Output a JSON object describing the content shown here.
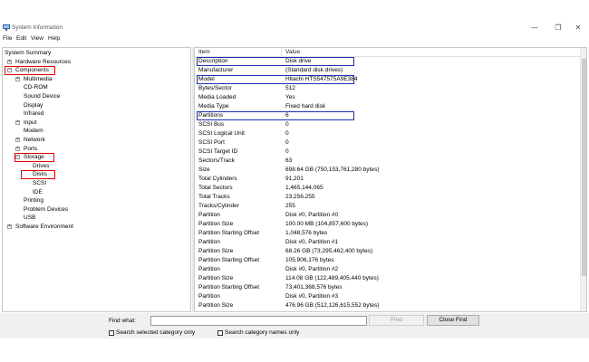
{
  "window": {
    "title": "System Information",
    "controls": {
      "minimize": "—",
      "maximize": "❐",
      "close": "✕"
    }
  },
  "menu": [
    "File",
    "Edit",
    "View",
    "Help"
  ],
  "tree": [
    {
      "label": "System Summary",
      "level": 0,
      "expander": ""
    },
    {
      "label": "Hardware Resources",
      "level": 1,
      "expander": "+"
    },
    {
      "label": "Components",
      "level": 1,
      "expander": "−"
    },
    {
      "label": "Multimedia",
      "level": 2,
      "expander": "+"
    },
    {
      "label": "CD-ROM",
      "level": 2,
      "expander": ""
    },
    {
      "label": "Sound Device",
      "level": 2,
      "expander": ""
    },
    {
      "label": "Display",
      "level": 2,
      "expander": ""
    },
    {
      "label": "Infrared",
      "level": 2,
      "expander": ""
    },
    {
      "label": "Input",
      "level": 2,
      "expander": "+"
    },
    {
      "label": "Modem",
      "level": 2,
      "expander": ""
    },
    {
      "label": "Network",
      "level": 2,
      "expander": "+"
    },
    {
      "label": "Ports",
      "level": 2,
      "expander": "+"
    },
    {
      "label": "Storage",
      "level": 2,
      "expander": "−"
    },
    {
      "label": "Drives",
      "level": 3,
      "expander": ""
    },
    {
      "label": "Disks",
      "level": 3,
      "expander": ""
    },
    {
      "label": "SCSI",
      "level": 3,
      "expander": ""
    },
    {
      "label": "IDE",
      "level": 3,
      "expander": ""
    },
    {
      "label": "Printing",
      "level": 2,
      "expander": ""
    },
    {
      "label": "Problem Devices",
      "level": 2,
      "expander": ""
    },
    {
      "label": "USB",
      "level": 2,
      "expander": ""
    },
    {
      "label": "Software Environment",
      "level": 1,
      "expander": "+"
    }
  ],
  "list": {
    "columns": {
      "item": "Item",
      "value": "Value"
    },
    "rows": [
      {
        "item": "Description",
        "value": "Disk drive"
      },
      {
        "item": "Manufacturer",
        "value": "(Standard disk drives)"
      },
      {
        "item": "Model",
        "value": "Hitachi HTS547575A9E384"
      },
      {
        "item": "Bytes/Sector",
        "value": "512"
      },
      {
        "item": "Media Loaded",
        "value": "Yes"
      },
      {
        "item": "Media Type",
        "value": "Fixed hard disk"
      },
      {
        "item": "Partitions",
        "value": "6"
      },
      {
        "item": "SCSI Bus",
        "value": "0"
      },
      {
        "item": "SCSI Logical Unit",
        "value": "0"
      },
      {
        "item": "SCSI Port",
        "value": "0"
      },
      {
        "item": "SCSI Target ID",
        "value": "0"
      },
      {
        "item": "Sectors/Track",
        "value": "63"
      },
      {
        "item": "Size",
        "value": "698.64 GB (750,153,761,280 bytes)"
      },
      {
        "item": "Total Cylinders",
        "value": "91,201"
      },
      {
        "item": "Total Sectors",
        "value": "1,465,144,065"
      },
      {
        "item": "Total Tracks",
        "value": "23,256,255"
      },
      {
        "item": "Tracks/Cylinder",
        "value": "255"
      },
      {
        "item": "Partition",
        "value": "Disk #0, Partition #0"
      },
      {
        "item": "Partition Size",
        "value": "100.00 MB (104,857,600 bytes)"
      },
      {
        "item": "Partition Starting Offset",
        "value": "1,048,576 bytes"
      },
      {
        "item": "Partition",
        "value": "Disk #0, Partition #1"
      },
      {
        "item": "Partition Size",
        "value": "68.26 GB (73,295,462,400 bytes)"
      },
      {
        "item": "Partition Starting Offset",
        "value": "105,906,176 bytes"
      },
      {
        "item": "Partition",
        "value": "Disk #0, Partition #2"
      },
      {
        "item": "Partition Size",
        "value": "114.08 GB (122,489,405,440 bytes)"
      },
      {
        "item": "Partition Starting Offset",
        "value": "73,401,368,576 bytes"
      },
      {
        "item": "Partition",
        "value": "Disk #0, Partition #3"
      },
      {
        "item": "Partition Size",
        "value": "476.96 GB (512,126,615,552 bytes)"
      }
    ]
  },
  "find": {
    "label": "Find what:",
    "value": "",
    "find_button": "Find",
    "close_button": "Close Find",
    "option_selected_category": "Search selected category only",
    "option_category_names": "Search category names only"
  },
  "colors": {
    "highlight_red": "#e00000",
    "highlight_blue": "#1a2fb0"
  }
}
